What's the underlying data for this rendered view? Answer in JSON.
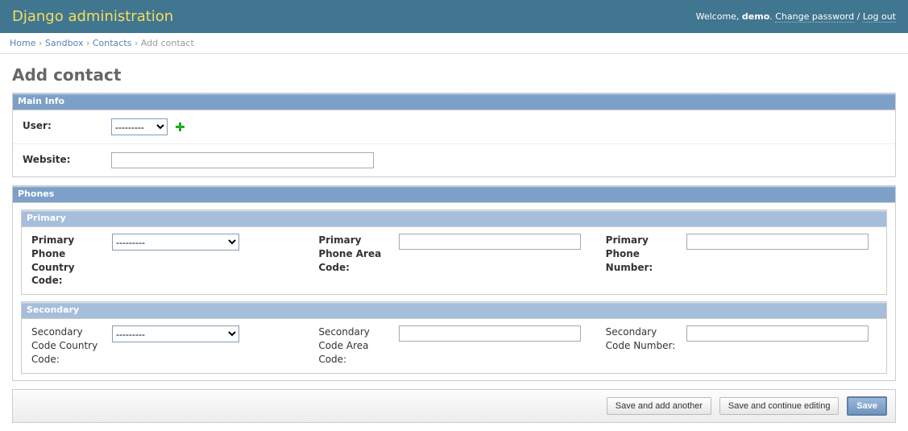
{
  "header": {
    "title": "Django administration",
    "welcome_prefix": "Welcome, ",
    "username": "demo",
    "change_password": "Change password",
    "logout": "Log out"
  },
  "breadcrumbs": {
    "home": "Home",
    "sandbox": "Sandbox",
    "contacts": "Contacts",
    "current": "Add contact",
    "sep": " › "
  },
  "page_title": "Add contact",
  "fieldsets": {
    "main_info": {
      "legend": "Main Info",
      "user_label": "User:",
      "user_selected": "---------",
      "website_label": "Website:",
      "website_value": ""
    },
    "phones": {
      "legend": "Phones",
      "primary": {
        "legend": "Primary",
        "country_code_label": "Primary Phone Country Code:",
        "country_code_selected": "---------",
        "area_code_label": "Primary Phone Area Code:",
        "area_code_value": "",
        "number_label": "Primary Phone Number:",
        "number_value": ""
      },
      "secondary": {
        "legend": "Secondary",
        "country_code_label": "Secondary Code Country Code:",
        "country_code_selected": "---------",
        "area_code_label": "Secondary Code Area Code:",
        "area_code_value": "",
        "number_label": "Secondary Code Number:",
        "number_value": ""
      }
    }
  },
  "actions": {
    "save_add_another": "Save and add another",
    "save_continue": "Save and continue editing",
    "save": "Save"
  }
}
